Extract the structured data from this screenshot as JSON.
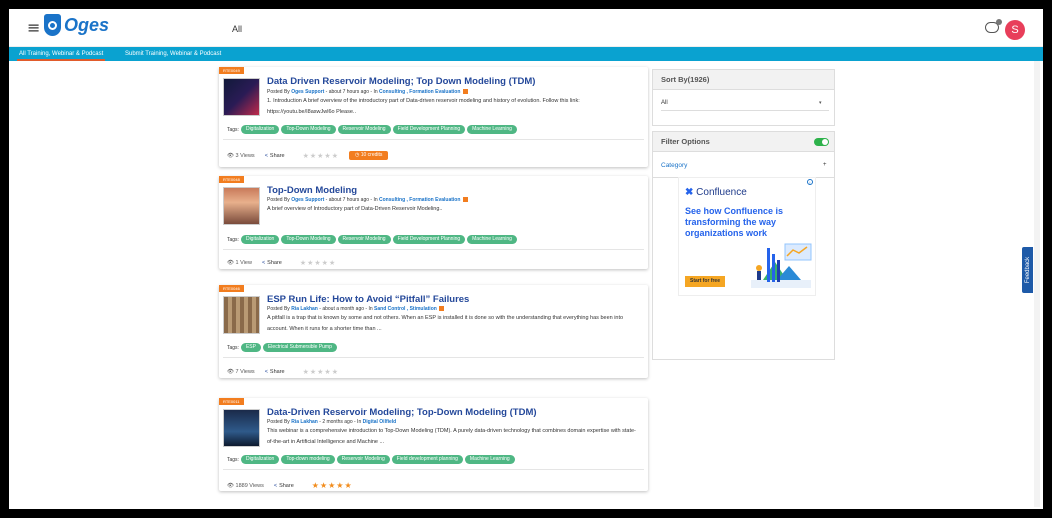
{
  "app": {
    "logo_text": "Oges",
    "top_filter": "All",
    "avatar_initial": "S"
  },
  "tabs": [
    {
      "label": "All Training, Webinar & Podcast",
      "active": true
    },
    {
      "label": "Submit Training, Webinar & Podcast",
      "active": false
    }
  ],
  "cards": [
    {
      "ribbon": "RTE0049",
      "title": "Data Driven Reservoir Modeling; Top Down Modeling (TDM)",
      "posted_by_prefix": "Posted By",
      "author": "Oges Support",
      "time": "- about 7 hours ago - In",
      "categories": "Consulting , Formation Evaluation",
      "description": "1. Introduction    A brief overview of the introductory part of Data-driven reservoir modeling and history of evolution.          Follow this link:   https://youtu.be/I8aswJwl6o    Please..",
      "tags_label": "Tags:",
      "tags": [
        "Digitalization",
        "Top-Down Modeling",
        "Reservoir Modeling",
        "Field Development Planning",
        "Machine Learning"
      ],
      "views": "3 Views",
      "share": "Share",
      "stars": "★★★★★",
      "rated": false,
      "credits": "10 credits"
    },
    {
      "ribbon": "RTE0048",
      "title": "Top-Down Modeling",
      "posted_by_prefix": "Posted By",
      "author": "Oges Support",
      "time": "- about 7 hours ago - In",
      "categories": "Consulting , Formation Evaluation",
      "description": "A brief overview of Introductory part of Data-Driven Reservoir Modeling..",
      "tags_label": "Tags:",
      "tags": [
        "Digitalization",
        "Top-Down Modeling",
        "Reservoir Modeling",
        "Field Development Planning",
        "Machine Learning"
      ],
      "views": "1 View",
      "share": "Share",
      "stars": "★★★★★",
      "rated": false,
      "credits": ""
    },
    {
      "ribbon": "RTE0046",
      "title": "ESP Run Life: How to Avoid “Pitfall” Failures",
      "posted_by_prefix": "Posted By",
      "author": "Ria Lakhan",
      "time": "- about a month ago - In",
      "categories": "Sand Control , Stimulation",
      "description": "A pitfall is a trap that is known by some and not others. When an ESP is installed it is done so with the understanding that everything has been into account. When it runs for a shorter time than ...",
      "tags_label": "Tags:",
      "tags": [
        "ESP",
        "Electrical Submersible Pump"
      ],
      "views": "7 Views",
      "share": "Share",
      "stars": "★★★★★",
      "rated": false,
      "credits": ""
    },
    {
      "ribbon": "RTE0011",
      "title": "Data-Driven Reservoir Modeling; Top-Down Modeling (TDM)",
      "posted_by_prefix": "Posted By",
      "author": "Ria Lakhan",
      "time": "- 2 months ago - In",
      "categories": "Digital Oilfield",
      "description": "This webinar is a comprehensive introduction to Top-Down Modeling (TDM). A purely data-driven technology that combines domain expertise with state-of-the-art in Artificial Intelligence and Machine ...",
      "tags_label": "Tags:",
      "tags": [
        "Digitalization",
        "Top-down modeling",
        "Reservoir Modeling",
        "Field development planning",
        "Machine Learning"
      ],
      "views": "1889 Views",
      "share": "Share",
      "stars": "★★★★★",
      "rated": true,
      "credits": ""
    }
  ],
  "sidebar": {
    "sort_title": "Sort By(1926)",
    "sort_value": "All",
    "filter_title": "Filter Options",
    "category_label": "Category",
    "category_caret": "+"
  },
  "ad": {
    "brand": "Confluence",
    "headline": "See how Confluence is transforming the way organizations work",
    "cta": "Start for free",
    "info": "i"
  },
  "feedback_label": "Feedback",
  "colors": {
    "topbar_tab": "#0aa2d0",
    "tag": "#4fb784",
    "ribbon": "#f27d1f",
    "title": "#24489a"
  }
}
